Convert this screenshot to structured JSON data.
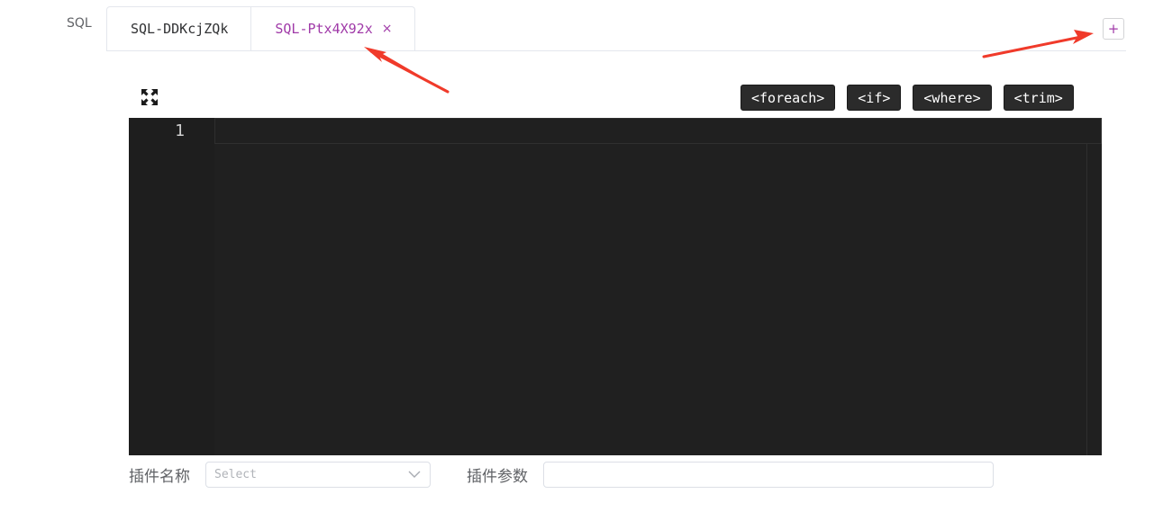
{
  "field": {
    "label": "SQL"
  },
  "tabs": [
    {
      "label": "SQL-DDKcjZQk",
      "active": false,
      "closable": false
    },
    {
      "label": "SQL-Ptx4X92x",
      "active": true,
      "closable": true
    }
  ],
  "tab_close_glyph": "×",
  "add_tab_glyph": "+",
  "toolbar": {
    "buttons": [
      {
        "label": "<foreach>"
      },
      {
        "label": "<if>"
      },
      {
        "label": "<where>"
      },
      {
        "label": "<trim>"
      }
    ]
  },
  "editor": {
    "line_numbers": [
      "1"
    ],
    "content": "",
    "background": "#202020"
  },
  "plugin": {
    "name_label": "插件名称",
    "select_placeholder": "Select",
    "params_label": "插件参数",
    "params_value": ""
  },
  "colors": {
    "accent": "#a03aa8",
    "annotation_arrow": "#f03a2a"
  },
  "icons": {
    "fullscreen": "fullscreen-icon",
    "close": "close-icon",
    "add": "plus-icon",
    "chevron": "chevron-down-icon"
  }
}
